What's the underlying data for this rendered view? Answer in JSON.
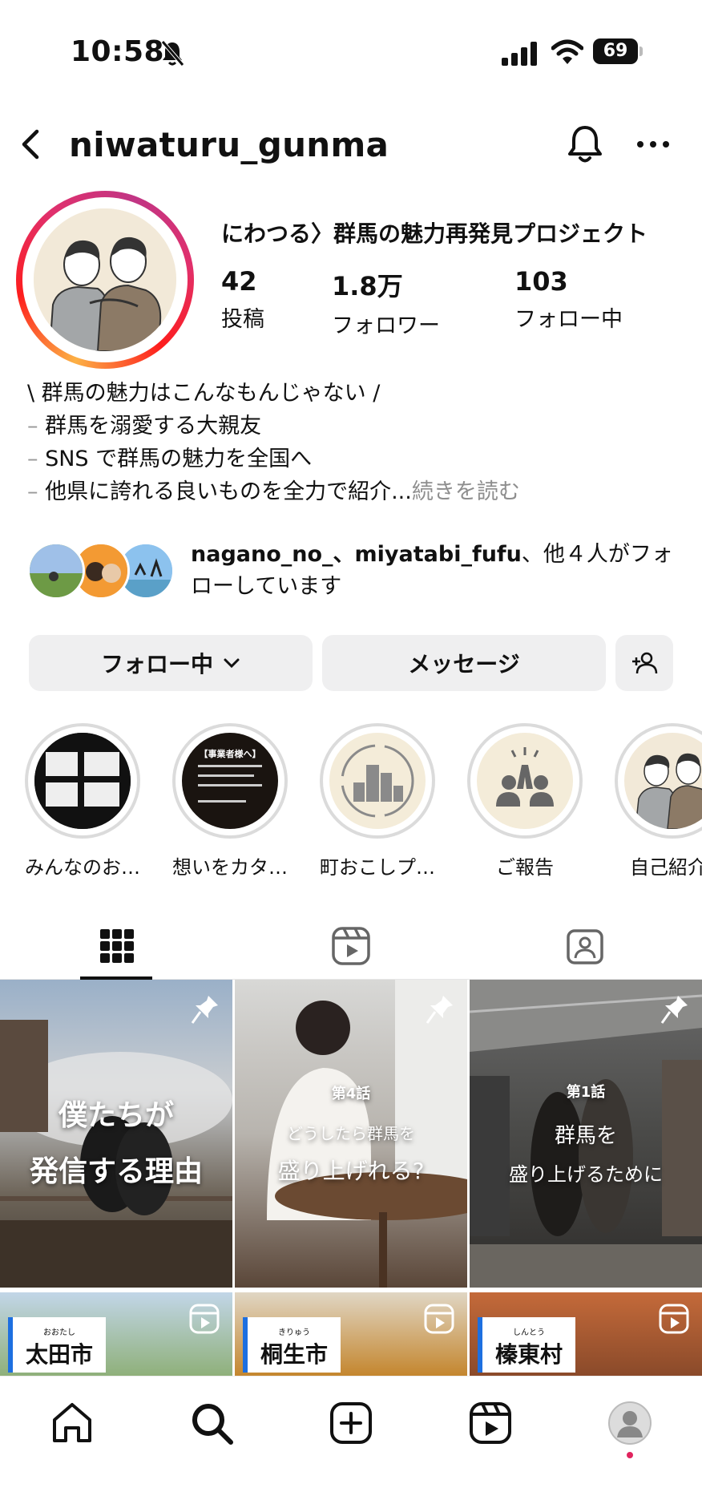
{
  "status_bar": {
    "time": "10:58",
    "battery": "69"
  },
  "header": {
    "username": "niwaturu_gunma"
  },
  "profile": {
    "display_name": "にわつる〉群馬の魅力再発見プロジェクト",
    "stats": [
      {
        "value": "42",
        "label": "投稿"
      },
      {
        "value": "1.8万",
        "label": "フォロワー"
      },
      {
        "value": "103",
        "label": "フォロー中"
      }
    ],
    "bio_lines": [
      "\\ 群馬の魅力はこんなもんじゃない /",
      "群馬を溺愛する大親友",
      "SNS で群馬の魅力を全国へ",
      "他県に誇れる良いものを全力で紹介..."
    ],
    "bio_dash": "–",
    "bio_more": "続きを読む",
    "followed_by_names": "nagano_no_、miyatabi_fufu",
    "followed_by_rest": "、他４人がフォローしています"
  },
  "buttons": {
    "following": "フォロー中",
    "message": "メッセージ"
  },
  "highlights": [
    {
      "label": "みんなのお…",
      "title": ""
    },
    {
      "label": "想いをカタ…",
      "title": "【事業者様へ】"
    },
    {
      "label": "町おこしプ…",
      "title": ""
    },
    {
      "label": "ご報告",
      "title": ""
    },
    {
      "label": "自己紹介",
      "title": ""
    }
  ],
  "posts": [
    {
      "episode": "",
      "line1": "僕たちが",
      "line2": "発信する理由"
    },
    {
      "episode": "第4話",
      "line1": "どうしたら群馬を",
      "line2": "盛り上げれる?"
    },
    {
      "episode": "第1話",
      "line1": "群馬を",
      "line2": "盛り上げるために"
    }
  ],
  "reels": [
    {
      "reading": "おおたし",
      "city": "太田市"
    },
    {
      "reading": "きりゅう",
      "city": "桐生市"
    },
    {
      "reading": "しんとう",
      "city": "榛東村"
    }
  ],
  "colors": {
    "accent_red": "#e0245e",
    "button_bg": "#efeff0",
    "city_bar": "#1d6fe0"
  }
}
